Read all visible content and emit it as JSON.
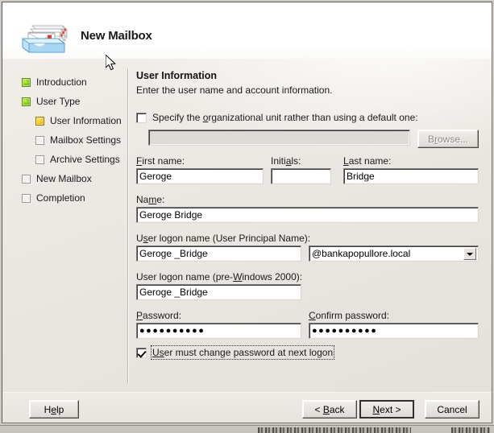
{
  "window": {
    "title": "New Mailbox",
    "icon": "mailbox-tray-icon"
  },
  "sidebar": {
    "items": [
      {
        "label": "Introduction",
        "state": "done",
        "level": 0
      },
      {
        "label": "User Type",
        "state": "done",
        "level": 0
      },
      {
        "label": "User Information",
        "state": "current",
        "level": 1
      },
      {
        "label": "Mailbox Settings",
        "state": "pending",
        "level": 1
      },
      {
        "label": "Archive Settings",
        "state": "pending",
        "level": 1
      },
      {
        "label": "New Mailbox",
        "state": "pending",
        "level": 0
      },
      {
        "label": "Completion",
        "state": "pending",
        "level": 0
      }
    ]
  },
  "content": {
    "title": "User Information",
    "subtitle": "Enter the user name and account information.",
    "ou_checkbox": {
      "label_pre": "Specify the ",
      "label_accel": "o",
      "label_post": "rganizational unit rather than using a default one:",
      "checked": false
    },
    "ou_field": {
      "value": "",
      "enabled": false
    },
    "browse_button": {
      "label_pre": "B",
      "label_accel": "r",
      "label_post": "owse...",
      "enabled": false
    },
    "first_name": {
      "label_accel": "F",
      "label_post": "irst name:",
      "value": "Geroge"
    },
    "initials": {
      "label_pre": "Initi",
      "label_accel": "a",
      "label_post": "ls:",
      "value": ""
    },
    "last_name": {
      "label_accel": "L",
      "label_post": "ast name:",
      "value": "Bridge"
    },
    "name": {
      "label_pre": "Na",
      "label_accel": "m",
      "label_post": "e:",
      "value": "Geroge  Bridge"
    },
    "upn": {
      "label_pre": "U",
      "label_accel": "s",
      "label_post": "er logon name (User Principal Name):",
      "value": "Geroge _Bridge"
    },
    "upn_domain": {
      "value": "@bankapopullore.local",
      "icon": "chevron-down-icon"
    },
    "pre_windows_logon": {
      "label_pre": "User logon name (pre-",
      "label_accel": "W",
      "label_post": "indows 2000):",
      "value": "Geroge _Bridge"
    },
    "password": {
      "label_accel": "P",
      "label_post": "assword:",
      "value": "●●●●●●●●●●"
    },
    "confirm_password": {
      "label_accel": "C",
      "label_post": "onfirm password:",
      "value": "●●●●●●●●●●"
    },
    "must_change": {
      "label_pre": "U",
      "label_accel": "s",
      "label_post": "er must change password at next logon",
      "checked": true,
      "focused": true
    }
  },
  "footer": {
    "help": {
      "label_pre": "H",
      "label_accel": "e",
      "label_post": "lp"
    },
    "back": {
      "label_pre": "< ",
      "label_accel": "B",
      "label_post": "ack"
    },
    "next": {
      "label_pre": "",
      "label_accel": "N",
      "label_post": "ext >",
      "is_default": true
    },
    "cancel": {
      "label_pre": "Cancel",
      "label_accel": "",
      "label_post": ""
    }
  },
  "colors": {
    "step_done": "#8fd01a",
    "step_current": "#ffc91f",
    "dialog_bg": "#ece9e3",
    "header_bg": "#ffffff"
  }
}
